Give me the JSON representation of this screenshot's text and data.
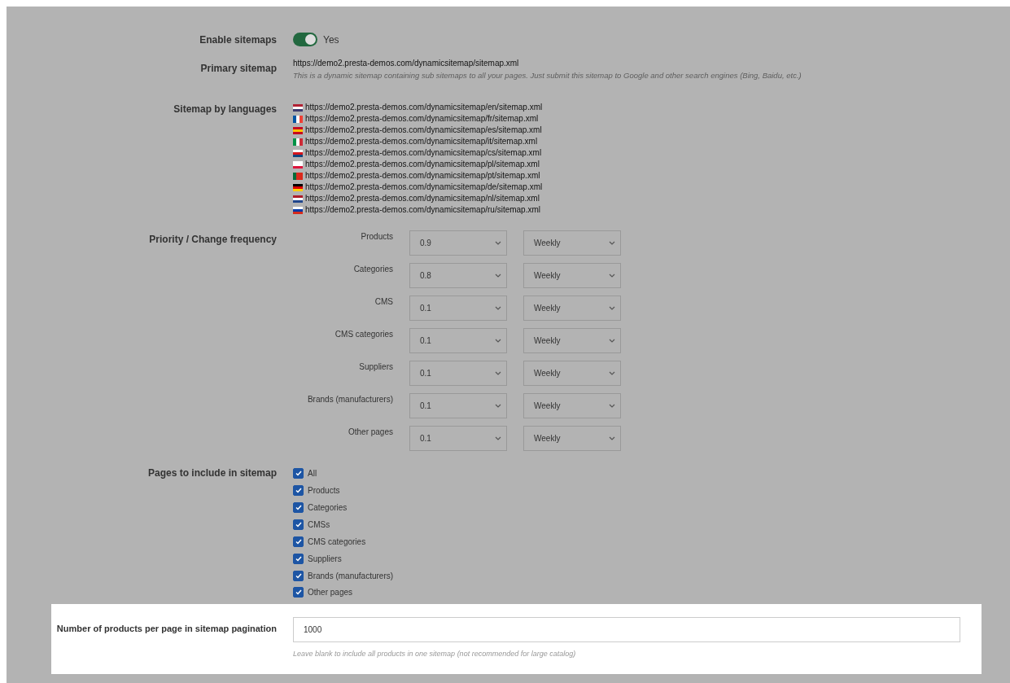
{
  "enable_sitemaps": {
    "label": "Enable sitemaps",
    "on": true,
    "value_label": "Yes"
  },
  "primary_sitemap": {
    "label": "Primary sitemap",
    "url": "https://demo2.presta-demos.com/dynamicsitemap/sitemap.xml",
    "help": "This is a dynamic sitemap containing sub sitemaps to all your pages. Just submit this sitemap to Google and other search engines (Bing, Baidu, etc.)"
  },
  "sitemap_by_languages": {
    "label": "Sitemap by languages",
    "urls": [
      "https://demo2.presta-demos.com/dynamicsitemap/en/sitemap.xml",
      "https://demo2.presta-demos.com/dynamicsitemap/fr/sitemap.xml",
      "https://demo2.presta-demos.com/dynamicsitemap/es/sitemap.xml",
      "https://demo2.presta-demos.com/dynamicsitemap/it/sitemap.xml",
      "https://demo2.presta-demos.com/dynamicsitemap/cs/sitemap.xml",
      "https://demo2.presta-demos.com/dynamicsitemap/pl/sitemap.xml",
      "https://demo2.presta-demos.com/dynamicsitemap/pt/sitemap.xml",
      "https://demo2.presta-demos.com/dynamicsitemap/de/sitemap.xml",
      "https://demo2.presta-demos.com/dynamicsitemap/nl/sitemap.xml",
      "https://demo2.presta-demos.com/dynamicsitemap/ru/sitemap.xml"
    ]
  },
  "priority": {
    "label": "Priority / Change frequency",
    "rows": [
      {
        "label": "Products",
        "priority": "0.9",
        "frequency": "Weekly"
      },
      {
        "label": "Categories",
        "priority": "0.8",
        "frequency": "Weekly"
      },
      {
        "label": "CMS",
        "priority": "0.1",
        "frequency": "Weekly"
      },
      {
        "label": "CMS categories",
        "priority": "0.1",
        "frequency": "Weekly"
      },
      {
        "label": "Suppliers",
        "priority": "0.1",
        "frequency": "Weekly"
      },
      {
        "label": "Brands (manufacturers)",
        "priority": "0.1",
        "frequency": "Weekly"
      },
      {
        "label": "Other pages",
        "priority": "0.1",
        "frequency": "Weekly"
      }
    ]
  },
  "pages": {
    "label": "Pages to include in sitemap",
    "items": [
      {
        "label": "All",
        "checked": true
      },
      {
        "label": "Products",
        "checked": true
      },
      {
        "label": "Categories",
        "checked": true
      },
      {
        "label": "CMSs",
        "checked": true
      },
      {
        "label": "CMS categories",
        "checked": true
      },
      {
        "label": "Suppliers",
        "checked": true
      },
      {
        "label": "Brands (manufacturers)",
        "checked": true
      },
      {
        "label": "Other pages",
        "checked": true
      }
    ]
  },
  "pagination": {
    "label": "Number of products per page in sitemap pagination",
    "value": "1000",
    "help": "Leave blank to include all products in one sitemap (not recommended for large catalog)"
  }
}
